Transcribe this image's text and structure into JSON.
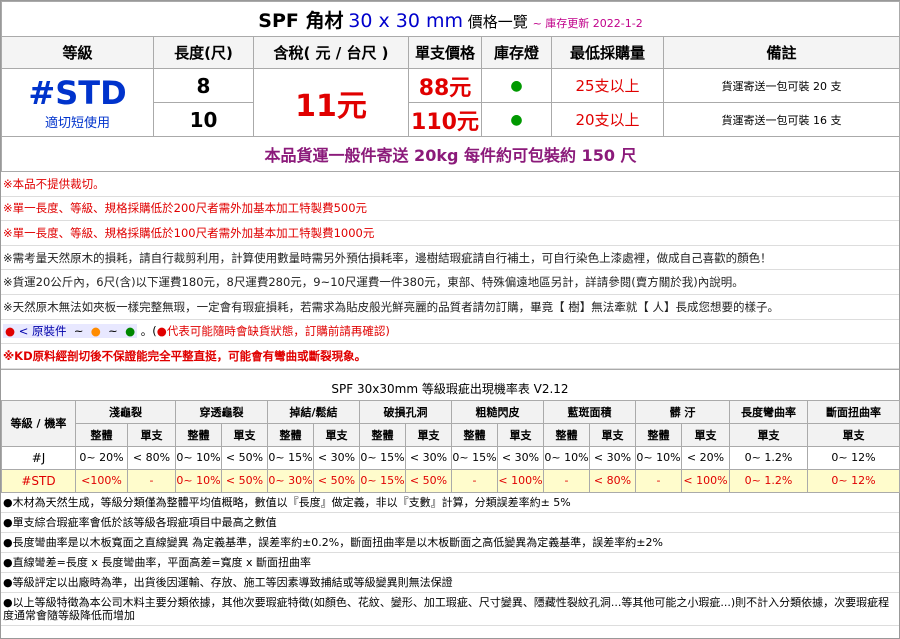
{
  "title": {
    "prefix": "SPF 角材",
    "dim": "30 x 30 mm",
    "suffix": "價格一覽",
    "updated": "~ 庫存更新 2022-1-2"
  },
  "headers": {
    "grade": "等級",
    "length": "長度(尺)",
    "tax": "含稅( 元 / 台尺 )",
    "unit_price": "單支價格",
    "stock": "庫存燈",
    "min_qty": "最低採購量",
    "remark": "備註"
  },
  "product": {
    "grade": "#STD",
    "grade_sub": "適切短使用",
    "tax_price": "11元",
    "rows": [
      {
        "length": "8",
        "unit_price": "88元",
        "stock": "●",
        "min_qty": "25支以上",
        "remark": "貨運寄送一包可裝 20 支"
      },
      {
        "length": "10",
        "unit_price": "110元",
        "stock": "●",
        "min_qty": "20支以上",
        "remark": "貨運寄送一包可裝 16 支"
      }
    ],
    "shipping": "本品貨運一般件寄送 20kg 每件約可包裝約 150 尺"
  },
  "notes": {
    "n1": "※本品不提供裁切。",
    "n2": "※單一長度、等級、規格採購低於200尺者需外加基本加工特製費500元",
    "n3": "※單一長度、等級、規格採購低於100尺者需外加基本加工特製費1000元",
    "n4": "※需考量天然原木的損耗，請自行裁剪利用，計算使用數量時需另外預估損耗率，邊樹結瑕疵請自行補土，可自行染色上漆處裡，做成自己喜歡的顏色！",
    "n5": "※貨運20公斤內，6尺(含)以下運費180元，8尺運費280元，9~10尺運費一件380元，東部、特殊偏遠地區另計，詳請參閱(賣方關於我)內說明。",
    "n6": "※天然原木無法如夾板一樣完整無瑕，一定會有瑕疵損耗，若需求為貼皮般光鮮亮麗的品質者請勿訂購，畢竟【 樹】無法牽就【 人】長成您想要的樣子。",
    "legend_dot": "●",
    "legend_tag": "< 原裝件",
    "legend_sep": "~",
    "legend_note": "代表可能隨時會缺貨狀態，訂購前請再確認)",
    "n8": "※KD原料經剖切後不保證能完全平整直挺，可能會有彎曲或斷裂現象。"
  },
  "defect": {
    "title": "SPF 30x30mm 等級瑕疵出現機率表 V2.12",
    "corner": "等級 / 機率",
    "groups": [
      "淺龜裂",
      "穿透龜裂",
      "掉結/鬆結",
      "破損孔洞",
      "粗糙閃皮",
      "藍斑面積",
      "髒 汙",
      "長度彎曲率",
      "斷面扭曲率"
    ],
    "sub_whole": "整體",
    "sub_piece": "單支",
    "rows": [
      {
        "grade": "#J",
        "cells": [
          "0~ 20%",
          "< 80%",
          "0~ 10%",
          "< 50%",
          "0~ 15%",
          "< 30%",
          "0~ 15%",
          "< 30%",
          "0~ 15%",
          "< 30%",
          "0~ 10%",
          "< 30%",
          "0~ 10%",
          "< 20%",
          "0~ 1.2%",
          "0~ 12%"
        ]
      },
      {
        "grade": "#STD",
        "cells": [
          "<100%",
          "-",
          "0~ 10%",
          "< 50%",
          "0~ 30%",
          "< 50%",
          "0~ 15%",
          "< 50%",
          "-",
          "< 100%",
          "-",
          "< 80%",
          "-",
          "< 100%",
          "0~ 1.2%",
          "0~ 12%"
        ]
      }
    ]
  },
  "footnotes": {
    "f1": "●木材為天然生成，等級分類僅為整體平均值概略，數值以『長度』做定義，非以『支數』計算，分類誤差率約± 5%",
    "f2": "●單支綜合瑕疵率會低於該等級各瑕疵項目中最高之數值",
    "f3": "●長度彎曲率是以木板寬面之直線變異 為定義基準，誤差率約±0.2%，斷面扭曲率是以木板斷面之高低變異為定義基準，誤差率約±2%",
    "f4": "●直線彎差=長度 x 長度彎曲率，平面高差=寬度 x 斷面扭曲率",
    "f5": "●等級評定以出廠時為準，出貨後因運輸、存放、施工等因素導致捕結或等級變異則無法保證",
    "f6": "●以上等級特徵為本公司木料主要分類依據，其他次要瑕疵特徵(如顏色、花紋、變形、加工瑕疵、尺寸變異、隱藏性裂紋孔洞...等其他可能之小瑕疵...)則不計入分類依據，次要瑕疵程度通常會隨等級降低而增加"
  }
}
